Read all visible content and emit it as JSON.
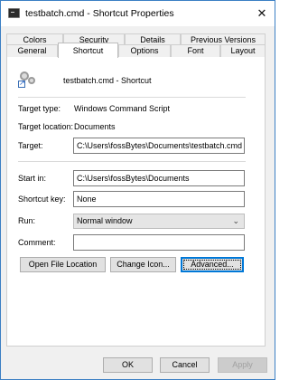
{
  "window": {
    "title": "testbatch.cmd - Shortcut Properties",
    "close_glyph": "✕"
  },
  "tabs": {
    "row1": [
      "Colors",
      "Security",
      "Details",
      "Previous Versions"
    ],
    "row2": [
      "General",
      "Shortcut",
      "Options",
      "Font",
      "Layout"
    ],
    "active": "Shortcut"
  },
  "shortcut": {
    "name": "testbatch.cmd - Shortcut",
    "icon": "batch-file-shortcut-icon"
  },
  "fields": {
    "target_type_label": "Target type:",
    "target_type_value": "Windows Command Script",
    "target_location_label": "Target location:",
    "target_location_value": "Documents",
    "target_label": "Target:",
    "target_value": "C:\\Users\\fossBytes\\Documents\\testbatch.cmd",
    "start_in_label": "Start in:",
    "start_in_value": "C:\\Users\\fossBytes\\Documents",
    "shortcut_key_label": "Shortcut key:",
    "shortcut_key_value": "None",
    "run_label": "Run:",
    "run_value": "Normal window",
    "comment_label": "Comment:",
    "comment_value": ""
  },
  "buttons": {
    "open_file_location": "Open File Location",
    "change_icon": "Change Icon...",
    "advanced": "Advanced...",
    "ok": "OK",
    "cancel": "Cancel",
    "apply": "Apply"
  },
  "colors": {
    "window_border": "#3b7fc4",
    "focus_blue": "#0078d7"
  }
}
